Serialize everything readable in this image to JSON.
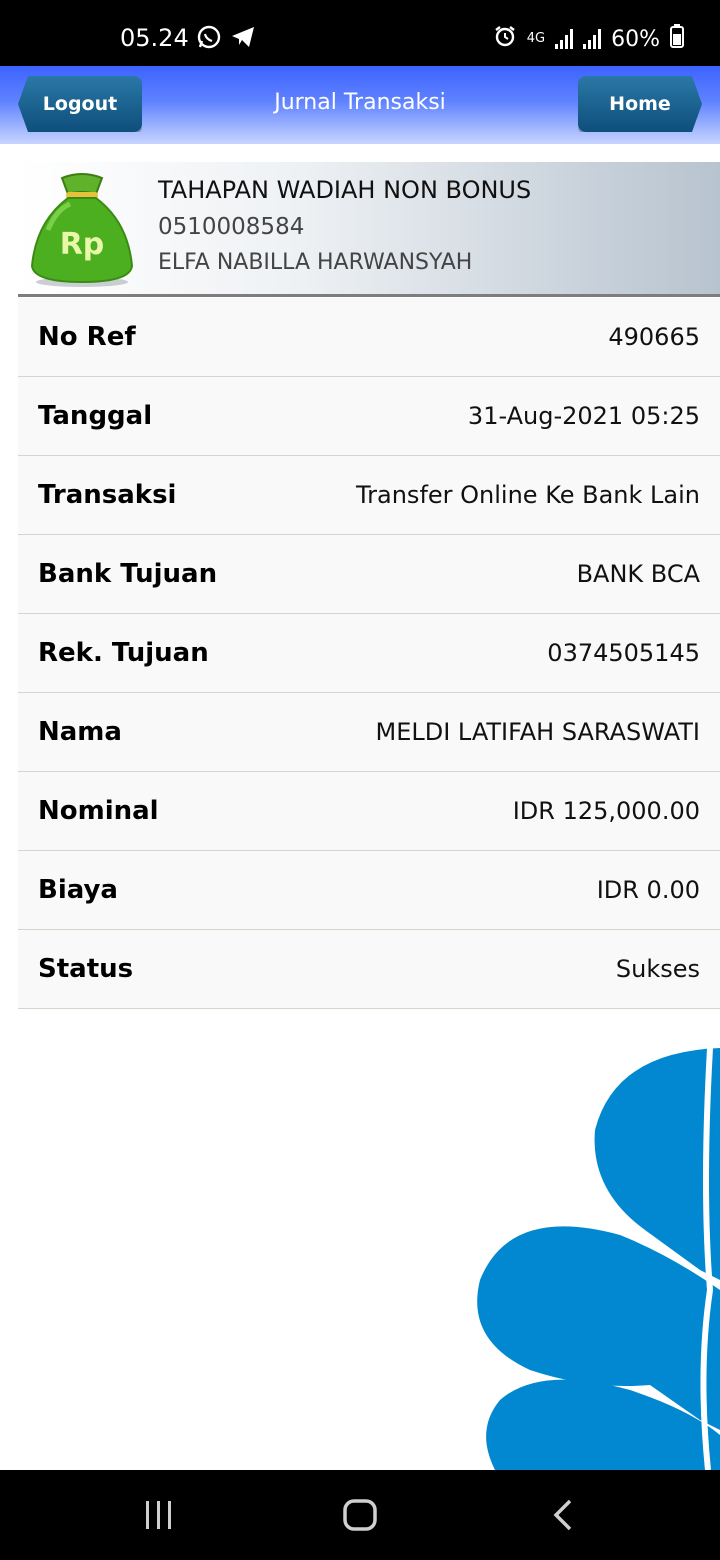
{
  "status_bar": {
    "time": "05.24",
    "network": "4G",
    "battery": "60%",
    "icons": [
      "whatsapp-icon",
      "telegram-icon",
      "alarm-icon",
      "signal-icon",
      "battery-icon"
    ]
  },
  "header": {
    "title": "Jurnal Transaksi",
    "logout_label": "Logout",
    "home_label": "Home"
  },
  "account": {
    "product": "TAHAPAN WADIAH NON BONUS",
    "number": "0510008584",
    "holder": "ELFA NABILLA HARWANSYAH",
    "icon": "money-bag-icon",
    "icon_text": "Rp"
  },
  "details": [
    {
      "label": "No Ref",
      "value": "490665"
    },
    {
      "label": "Tanggal",
      "value": "31-Aug-2021 05:25"
    },
    {
      "label": "Transaksi",
      "value": "Transfer Online Ke Bank Lain"
    },
    {
      "label": "Bank Tujuan",
      "value": "BANK BCA"
    },
    {
      "label": "Rek. Tujuan",
      "value": "0374505145"
    },
    {
      "label": "Nama",
      "value": "MELDI LATIFAH SARASWATI"
    },
    {
      "label": "Nominal",
      "value": "IDR 125,000.00"
    },
    {
      "label": "Biaya",
      "value": "IDR 0.00"
    },
    {
      "label": "Status",
      "value": "Sukses"
    }
  ],
  "colors": {
    "header_blue": "#3d63ff",
    "button_blue": "#0e4f7c",
    "logo_blue": "#0288d1",
    "bag_green": "#4caf1f"
  },
  "nav_bar": {
    "icons": [
      "recent-apps-icon",
      "home-circle-icon",
      "back-icon"
    ]
  }
}
